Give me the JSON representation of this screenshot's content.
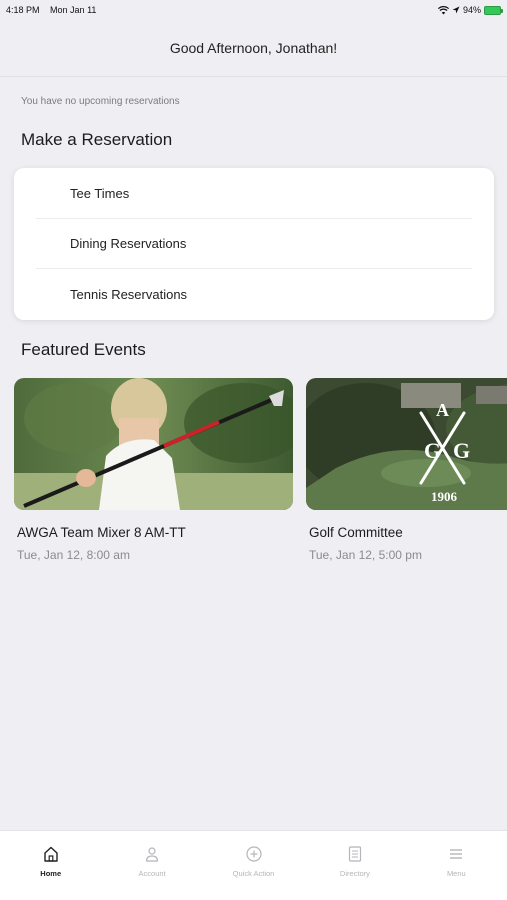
{
  "status_bar": {
    "time": "4:18 PM",
    "date": "Mon Jan 11",
    "battery": "94%"
  },
  "header": {
    "title": "Good Afternoon, Jonathan!"
  },
  "reservations": {
    "empty_message": "You have no upcoming reservations",
    "section_title": "Make a Reservation",
    "items": [
      {
        "label": "Tee Times"
      },
      {
        "label": "Dining Reservations"
      },
      {
        "label": "Tennis Reservations"
      }
    ]
  },
  "events": {
    "section_title": "Featured Events",
    "items": [
      {
        "name": "AWGA Team Mixer 8 AM-TT",
        "date": "Tue, Jan 12, 8:00 am",
        "image": "golfer-photo"
      },
      {
        "name": "Golf Committee",
        "date": "Tue, Jan 12, 5:00 pm",
        "image": "club-logo-aerial-photo"
      }
    ],
    "logo_text": "1906"
  },
  "tab_bar": {
    "items": [
      {
        "label": "Home",
        "icon": "home-icon",
        "active": true
      },
      {
        "label": "Account",
        "icon": "person-icon",
        "active": false
      },
      {
        "label": "Quick Action",
        "icon": "plus-circle-icon",
        "active": false
      },
      {
        "label": "Directory",
        "icon": "book-icon",
        "active": false
      },
      {
        "label": "Menu",
        "icon": "hamburger-icon",
        "active": false
      }
    ]
  },
  "colors": {
    "background": "#efeff3",
    "card": "#ffffff",
    "text_primary": "#1c1c1e",
    "text_secondary": "#8a8a8f",
    "tab_inactive": "#b5b5ba",
    "battery": "#34c759"
  }
}
